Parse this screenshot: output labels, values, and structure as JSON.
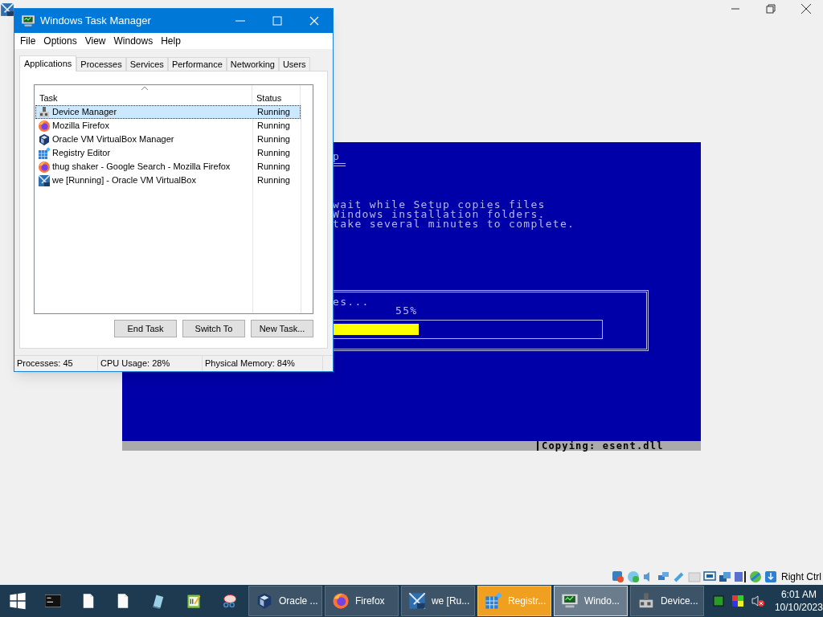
{
  "vm_screen": {
    "heading": "p",
    "lines": [
      "wait while Setup copies files",
      "Windows installation folders.",
      "take several minutes to complete."
    ],
    "progress_caption": "es...",
    "percent": "55%",
    "level": 0.55,
    "status_text": "Copying: esent.dll"
  },
  "vm_status_bar": {
    "host_key": "Right Ctrl"
  },
  "task_manager": {
    "title": "Windows Task Manager",
    "menu": [
      "File",
      "Options",
      "View",
      "Windows",
      "Help"
    ],
    "tabs": [
      {
        "label": "Applications",
        "selected": true
      },
      {
        "label": "Processes",
        "selected": false
      },
      {
        "label": "Services",
        "selected": false
      },
      {
        "label": "Performance",
        "selected": false
      },
      {
        "label": "Networking",
        "selected": false
      },
      {
        "label": "Users",
        "selected": false
      }
    ],
    "columns": [
      "Task",
      "Status"
    ],
    "rows": [
      {
        "kind": "device",
        "task": "Device Manager",
        "status": "Running",
        "selected": true
      },
      {
        "kind": "firefox",
        "task": "Mozilla Firefox",
        "status": "Running",
        "selected": false
      },
      {
        "kind": "virtualbox",
        "task": "Oracle VM VirtualBox Manager",
        "status": "Running",
        "selected": false
      },
      {
        "kind": "registry",
        "task": "Registry Editor",
        "status": "Running",
        "selected": false
      },
      {
        "kind": "firefox",
        "task": "thug shaker - Google Search - Mozilla Firefox",
        "status": "Running",
        "selected": false
      },
      {
        "kind": "vm",
        "task": "we [Running] - Oracle VM VirtualBox",
        "status": "Running",
        "selected": false
      }
    ],
    "buttons": [
      "End Task",
      "Switch To",
      "New Task..."
    ],
    "status_bar": [
      "Processes: 45",
      "CPU Usage: 28%",
      "Physical Memory: 84%"
    ]
  },
  "taskbar": {
    "pinned": [
      {
        "kind": "start"
      },
      {
        "kind": "cmd"
      },
      {
        "kind": "document"
      },
      {
        "kind": "document"
      },
      {
        "kind": "notepad"
      },
      {
        "kind": "editor"
      },
      {
        "kind": "snip"
      }
    ],
    "windows": [
      {
        "kind": "virtualbox",
        "label": "Oracle ...",
        "selected": false,
        "attention": false
      },
      {
        "kind": "firefox",
        "label": "Firefox",
        "selected": false,
        "attention": false
      },
      {
        "kind": "vm",
        "label": "we [Ru...",
        "selected": false,
        "attention": false
      },
      {
        "kind": "registry",
        "label": "Registr...",
        "selected": false,
        "attention": true
      },
      {
        "kind": "monitor",
        "label": "Windo...",
        "selected": true,
        "attention": false
      },
      {
        "kind": "device",
        "label": "Device...",
        "selected": false,
        "attention": false
      }
    ],
    "time": "6:01 AM",
    "date": "10/10/2023"
  }
}
